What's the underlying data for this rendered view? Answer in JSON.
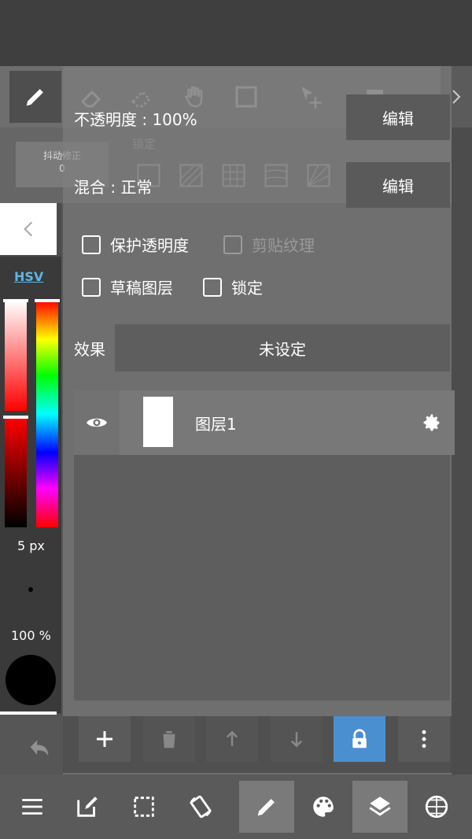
{
  "top_toolbar": {
    "stab_label": "抖动修正",
    "stab_value": "0",
    "lock_label": "锁定"
  },
  "layer_props": {
    "opacity_text": "不透明度 : 100%",
    "blend_text": "混合 : 正常",
    "edit_label": "编辑",
    "checkboxes": [
      {
        "label": "保护透明度",
        "checked": false,
        "enabled": true
      },
      {
        "label": "剪贴纹理",
        "checked": false,
        "enabled": false
      },
      {
        "label": "草稿图层",
        "checked": false,
        "enabled": true
      },
      {
        "label": "锁定",
        "checked": false,
        "enabled": true
      }
    ],
    "effect_label": "效果",
    "effect_value": "未设定"
  },
  "layers": [
    {
      "name": "图层1",
      "visible": true
    }
  ],
  "color_panel": {
    "mode": "HSV",
    "brush_size": "5 px",
    "opacity": "100 %",
    "current_color": "#000000"
  },
  "colors": {
    "accent_blue": "#4a8fd0",
    "hsv_link": "#5ab6e6"
  }
}
